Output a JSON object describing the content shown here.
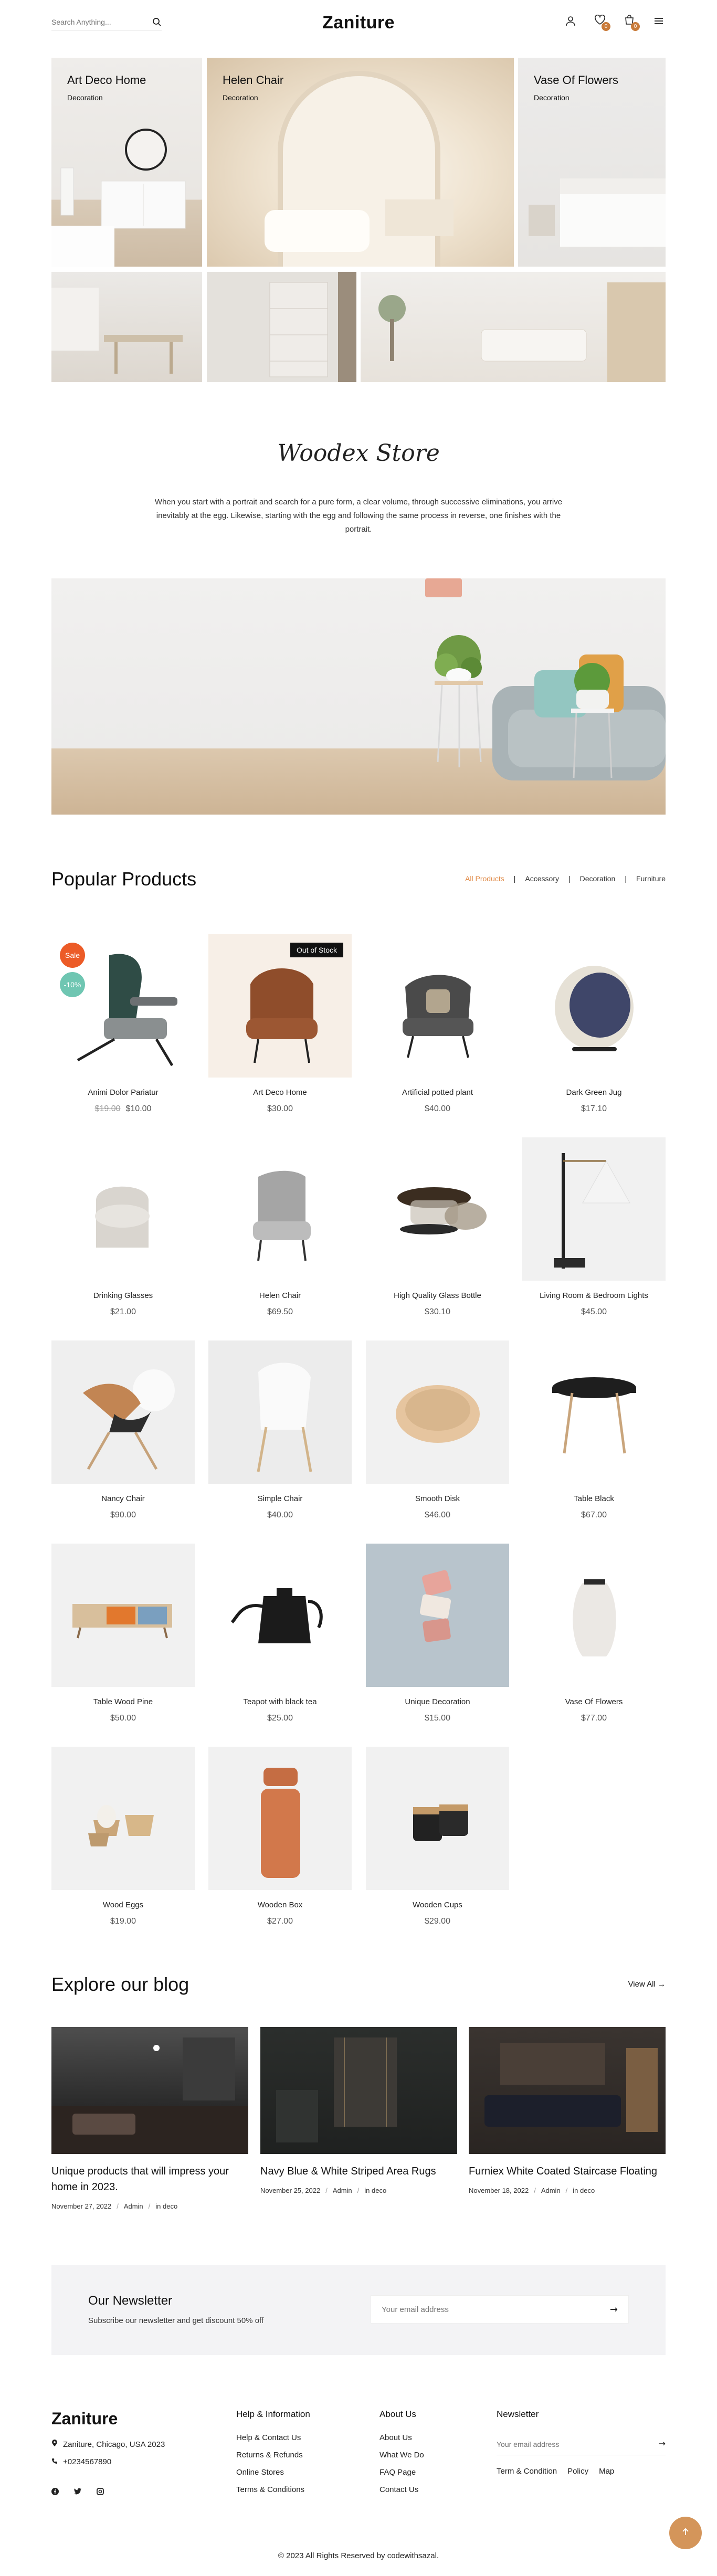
{
  "header": {
    "search_placeholder": "Search Anything...",
    "logo": "Zaniture",
    "wishlist_count": "0",
    "cart_count": "0",
    "icons": [
      "search-icon",
      "user-icon",
      "heart-icon",
      "cart-icon",
      "menu-icon"
    ]
  },
  "banners": [
    {
      "title": "Art Deco Home",
      "subtitle": "Decoration"
    },
    {
      "title": "Helen Chair",
      "subtitle": "Decoration"
    },
    {
      "title": "Vase Of Flowers",
      "subtitle": "Decoration"
    }
  ],
  "story": {
    "title": "Woodex Store",
    "text": "When you start with a portrait and search for a pure form, a clear volume, through successive eliminations, you arrive inevitably at the egg. Likewise, starting with the egg and following the same process in reverse, one finishes with the portrait."
  },
  "popular": {
    "title": "Popular Products",
    "filters": [
      "All Products",
      "Accessory",
      "Decoration",
      "Furniture"
    ],
    "active_filter": "All Products",
    "products": [
      {
        "name": "Animi Dolor Pariatur",
        "old_price": "$19.00",
        "price": "$10.00",
        "sale": "Sale",
        "off": "-10%"
      },
      {
        "name": "Art Deco Home",
        "price": "$30.00",
        "stock": "Out of Stock"
      },
      {
        "name": "Artificial potted plant",
        "price": "$40.00"
      },
      {
        "name": "Dark Green Jug",
        "price": "$17.10"
      },
      {
        "name": "Drinking Glasses",
        "price": "$21.00"
      },
      {
        "name": "Helen Chair",
        "price": "$69.50"
      },
      {
        "name": "High Quality Glass Bottle",
        "price": "$30.10"
      },
      {
        "name": "Living Room & Bedroom Lights",
        "price": "$45.00"
      },
      {
        "name": "Nancy Chair",
        "price": "$90.00"
      },
      {
        "name": "Simple Chair",
        "price": "$40.00"
      },
      {
        "name": "Smooth Disk",
        "price": "$46.00"
      },
      {
        "name": "Table Black",
        "price": "$67.00"
      },
      {
        "name": "Table Wood Pine",
        "price": "$50.00"
      },
      {
        "name": "Teapot with black tea",
        "price": "$25.00"
      },
      {
        "name": "Unique Decoration",
        "price": "$15.00"
      },
      {
        "name": "Vase Of Flowers",
        "price": "$77.00"
      },
      {
        "name": "Wood Eggs",
        "price": "$19.00"
      },
      {
        "name": "Wooden Box",
        "price": "$27.00"
      },
      {
        "name": "Wooden Cups",
        "price": "$29.00"
      }
    ]
  },
  "blog": {
    "title": "Explore our blog",
    "view_all": "View All",
    "posts": [
      {
        "title": "Unique products that will impress your home in 2023.",
        "date": "November 27, 2022",
        "author": "Admin",
        "category": "in deco"
      },
      {
        "title": "Navy Blue & White Striped Area Rugs",
        "date": "November 25, 2022",
        "author": "Admin",
        "category": "in deco"
      },
      {
        "title": "Furniex White Coated Staircase Floating",
        "date": "November 18, 2022",
        "author": "Admin",
        "category": "in deco"
      }
    ]
  },
  "newsletter": {
    "title": "Our Newsletter",
    "text": "Subscribe our newsletter and get discount 50% off",
    "placeholder": "Your email address"
  },
  "footer": {
    "logo": "Zaniture",
    "address": "Zaniture, Chicago, USA 2023",
    "phone": "+0234567890",
    "social": [
      "facebook-icon",
      "twitter-icon",
      "instagram-icon"
    ],
    "help": {
      "title": "Help & Information",
      "links": [
        "Help & Contact Us",
        "Returns & Refunds",
        "Online Stores",
        "Terms & Conditions"
      ]
    },
    "about": {
      "title": "About Us",
      "links": [
        "About Us",
        "What We Do",
        "FAQ Page",
        "Contact Us"
      ]
    },
    "newsletter": {
      "title": "Newsletter",
      "placeholder": "Your email address",
      "links": [
        "Term & Condition",
        "Policy",
        "Map"
      ]
    },
    "copyright": "© 2023 All Rights Reserved by codewithsazal."
  }
}
